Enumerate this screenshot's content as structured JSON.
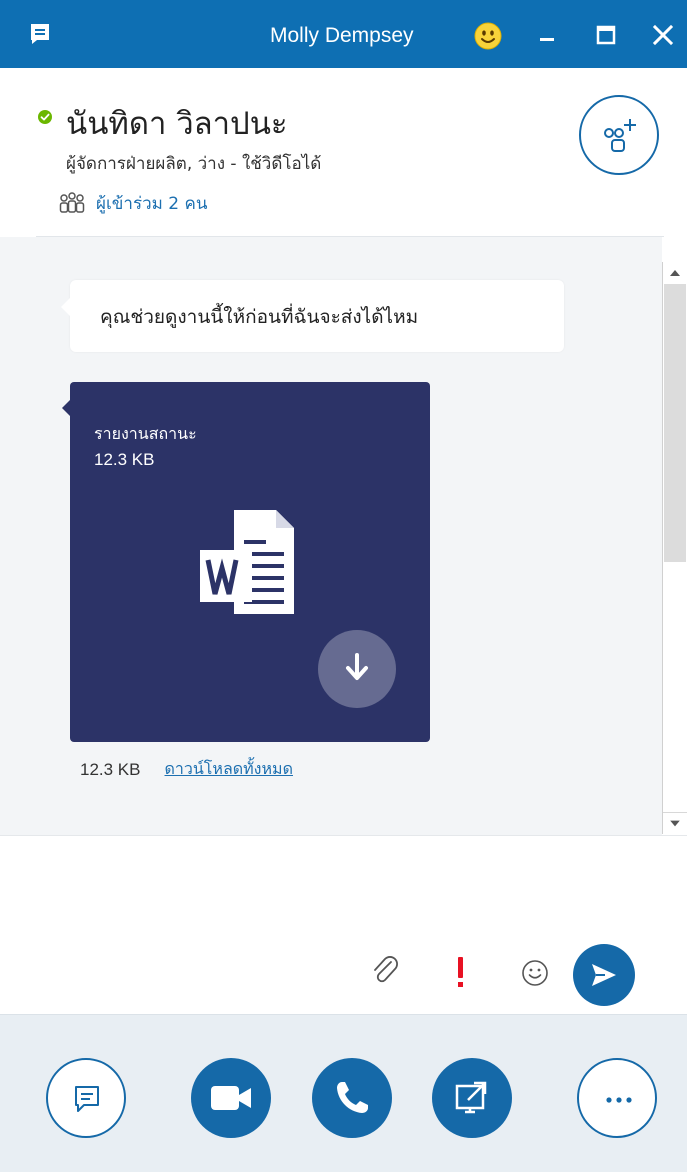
{
  "window": {
    "title": "Molly Dempsey",
    "app_icon": "chat-bubble-icon",
    "controls": [
      "minimize",
      "maximize",
      "close"
    ]
  },
  "contact": {
    "name": "นันทิดา วิลาปนะ",
    "presence": "available",
    "presence_color": "#6bb700",
    "status": "ผู้จัดการฝ่ายผลิต, ว่าง - ใช้วิดีโอได้",
    "participants_label": "ผู้เข้าร่วม 2 คน"
  },
  "conversation": {
    "messages": [
      {
        "type": "text",
        "text": "คุณช่วยดูงานนี้ให้ก่อนที่ฉันจะส่งได้ไหม"
      }
    ],
    "file": {
      "name": "รายงานสถานะ",
      "size": "12.3 KB",
      "file_type_icon": "word-document-icon"
    },
    "footer": {
      "size": "12.3 KB",
      "download_all_label": "ดาวน์โหลดทั้งหมด"
    }
  },
  "compose": {
    "placeholder": "",
    "value": ""
  },
  "colors": {
    "titlebar": "#0e6fb3",
    "accent": "#1569a8",
    "file_card": "#2c3367",
    "conversation_bg": "#f3f5f7",
    "toolbar_bg": "#e8eef3"
  }
}
